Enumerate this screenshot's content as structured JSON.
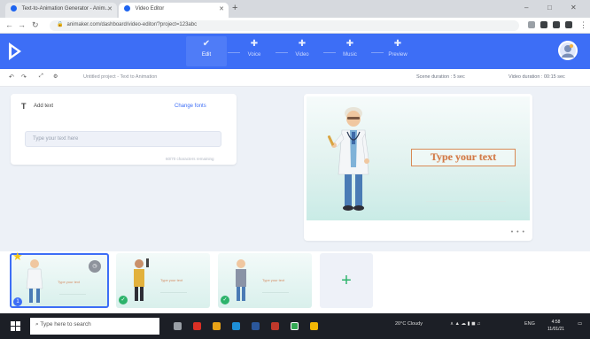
{
  "browser": {
    "tabs": [
      {
        "title": "Text-to-Animation Generator - Anim..."
      },
      {
        "title": "Video Editor"
      }
    ],
    "new_tab": "+",
    "url": "animaker.com/dashboard/video-editor/?project=123abc",
    "window_controls": [
      "–",
      "□",
      "✕"
    ]
  },
  "app": {
    "nav": [
      {
        "icon": "✔",
        "label": "Edit",
        "active": true
      },
      {
        "icon": "✚",
        "label": "Voice",
        "active": false
      },
      {
        "icon": "✚",
        "label": "Video",
        "active": false
      },
      {
        "icon": "✚",
        "label": "Music",
        "active": false
      },
      {
        "icon": "✚",
        "label": "Preview",
        "active": false
      }
    ]
  },
  "toolbar": {
    "undo_icon": "↶",
    "redo_icon": "↷",
    "project_title": "Untitled project - Text to Animation",
    "scene_duration": "Scene duration : 5 sec",
    "video_duration": "Video duration : 00:15 sec"
  },
  "text_panel": {
    "icon": "T",
    "title": "Add text",
    "change_font": "Change fonts",
    "input_placeholder": "Type your text here",
    "char_count": "60/70 characters remaining"
  },
  "canvas": {
    "text": "Type your text",
    "more": "• • •"
  },
  "scenes": [
    {
      "text": "Type your text",
      "selected": true,
      "badge": "1"
    },
    {
      "text": "Type your text",
      "selected": false
    },
    {
      "text": "Type your text",
      "selected": false
    }
  ],
  "add_scene": "+",
  "taskbar": {
    "search_placeholder": "Type here to search",
    "weather": "20°C Cloudy",
    "lang": "ENG",
    "time": "4:58",
    "date": "11/01/21"
  },
  "colors": {
    "brand_blue": "#3d6ef6",
    "accent_green": "#2db36b",
    "scene_text": "#d07a49"
  }
}
